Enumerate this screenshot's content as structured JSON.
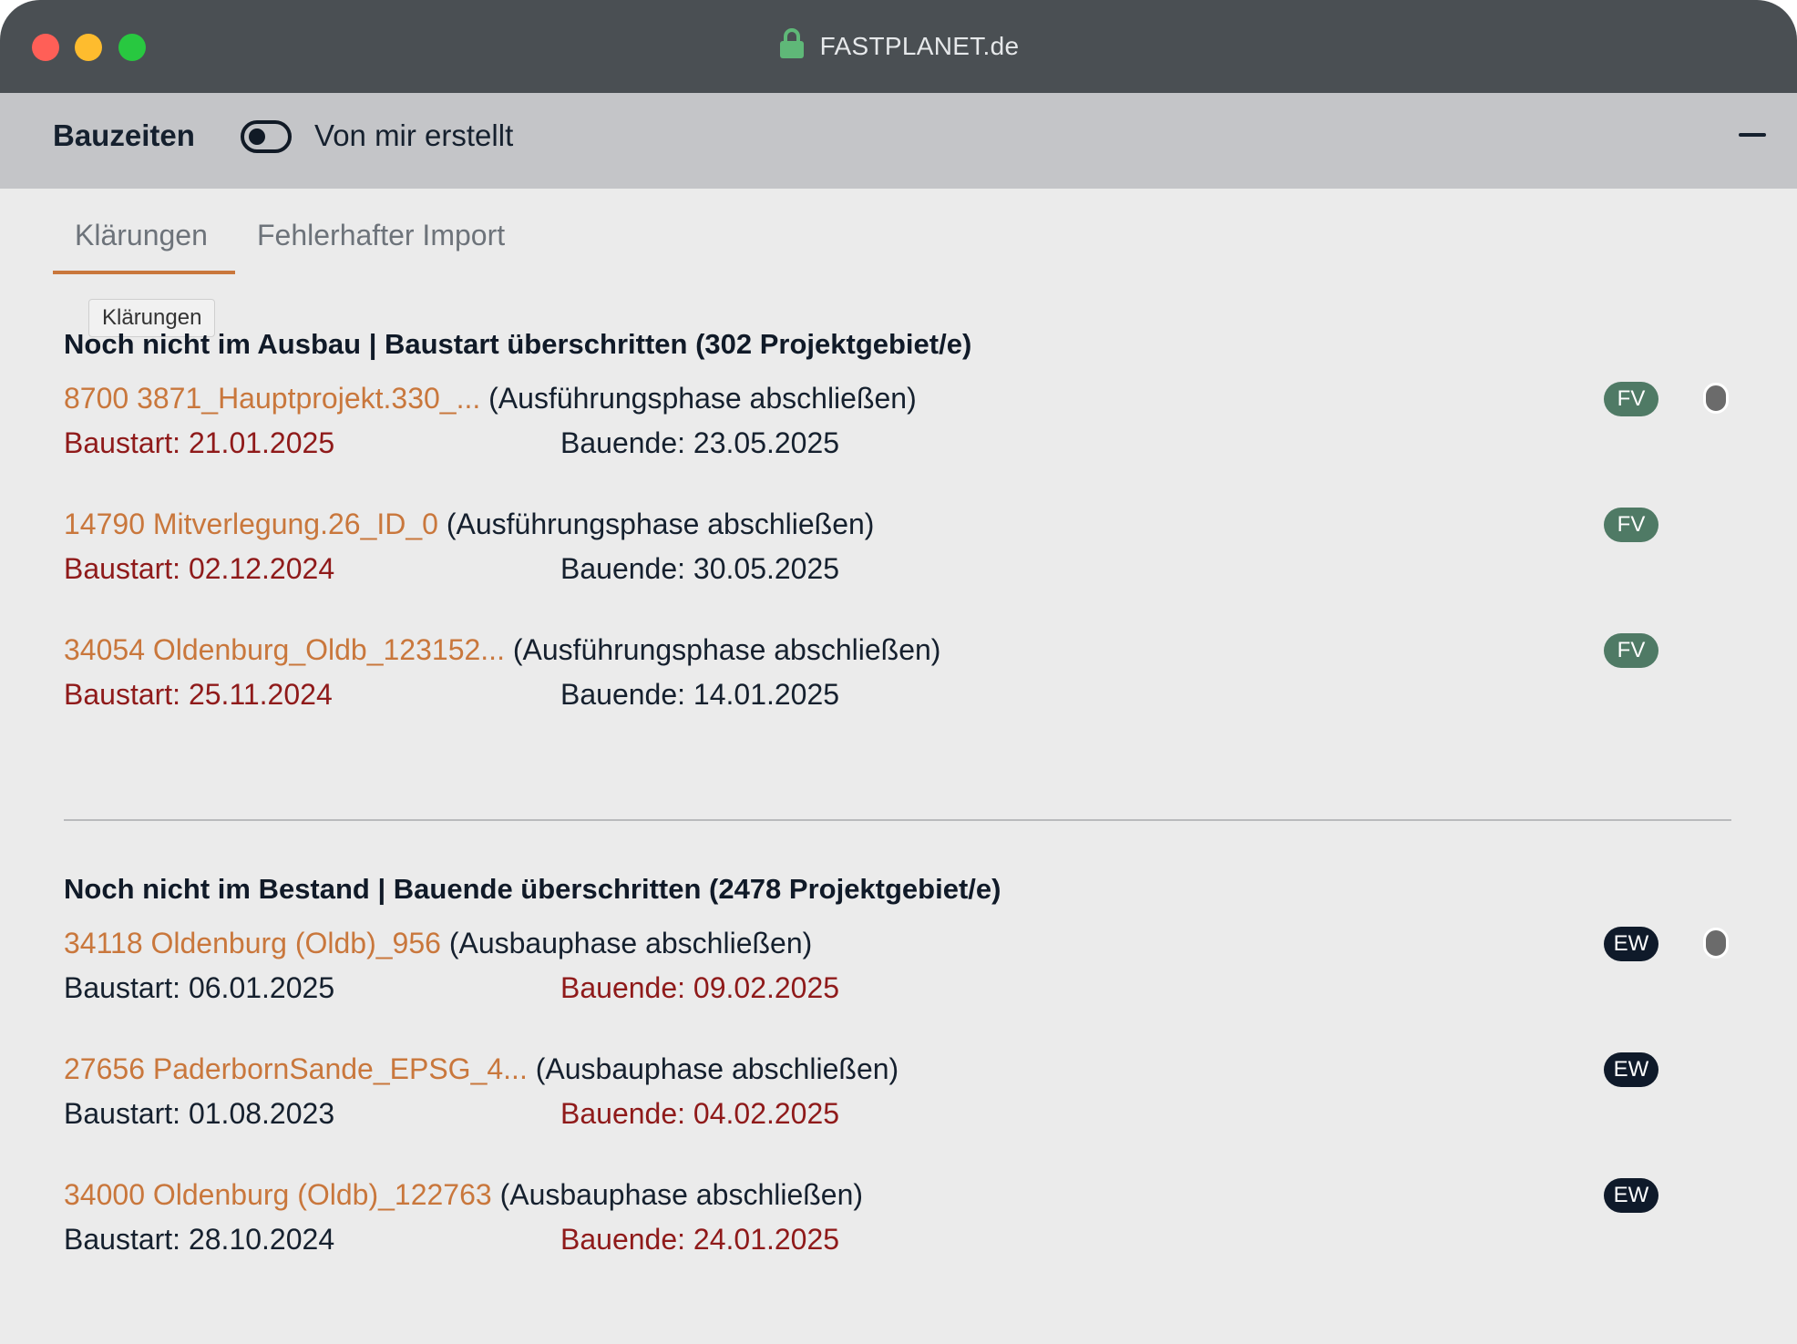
{
  "window": {
    "title": "FASTPLANET.de"
  },
  "header": {
    "title": "Bauzeiten",
    "toggle_label": "Von mir erstellt",
    "toggle_on": false
  },
  "tabs": [
    {
      "label": "Klärungen",
      "active": true
    },
    {
      "label": "Fehlerhafter Import",
      "active": false
    }
  ],
  "tooltip": "Klärungen",
  "sections": [
    {
      "title": "Noch nicht im Ausbau | Baustart überschritten (302 Projektgebiet/e)",
      "rows": [
        {
          "name": "8700 3871_Hauptprojekt.330_...",
          "phase": "(Ausführungsphase abschließen)",
          "start": "Baustart: 21.01.2025",
          "end": "Bauende: 23.05.2025",
          "badge": "FV"
        },
        {
          "name": "14790 Mitverlegung.26_ID_0",
          "phase": "(Ausführungsphase abschließen)",
          "start": "Baustart: 02.12.2024",
          "end": "Bauende: 30.05.2025",
          "badge": "FV"
        },
        {
          "name": "34054 Oldenburg_Oldb_123152...",
          "phase": "(Ausführungsphase abschließen)",
          "start": "Baustart: 25.11.2024",
          "end": "Bauende: 14.01.2025",
          "badge": "FV"
        }
      ]
    },
    {
      "title": "Noch nicht im Bestand | Bauende überschritten (2478 Projektgebiet/e)",
      "rows": [
        {
          "name": "34118 Oldenburg (Oldb)_956",
          "phase": "(Ausbauphase abschließen)",
          "start": "Baustart: 06.01.2025",
          "end": "Bauende: 09.02.2025",
          "badge": "EW"
        },
        {
          "name": "27656 PaderbornSande_EPSG_4...",
          "phase": "(Ausbauphase abschließen)",
          "start": "Baustart: 01.08.2023",
          "end": "Bauende: 04.02.2025",
          "badge": "EW"
        },
        {
          "name": "34000 Oldenburg (Oldb)_122763",
          "phase": "(Ausbauphase abschließen)",
          "start": "Baustart: 28.10.2024",
          "end": "Bauende: 24.01.2025",
          "badge": "EW"
        }
      ]
    }
  ],
  "colors": {
    "accent": "#c9773c",
    "overdue": "#8f1a1a",
    "badge_fv": "#4f7a65",
    "badge_ew": "#0f1a2a"
  }
}
